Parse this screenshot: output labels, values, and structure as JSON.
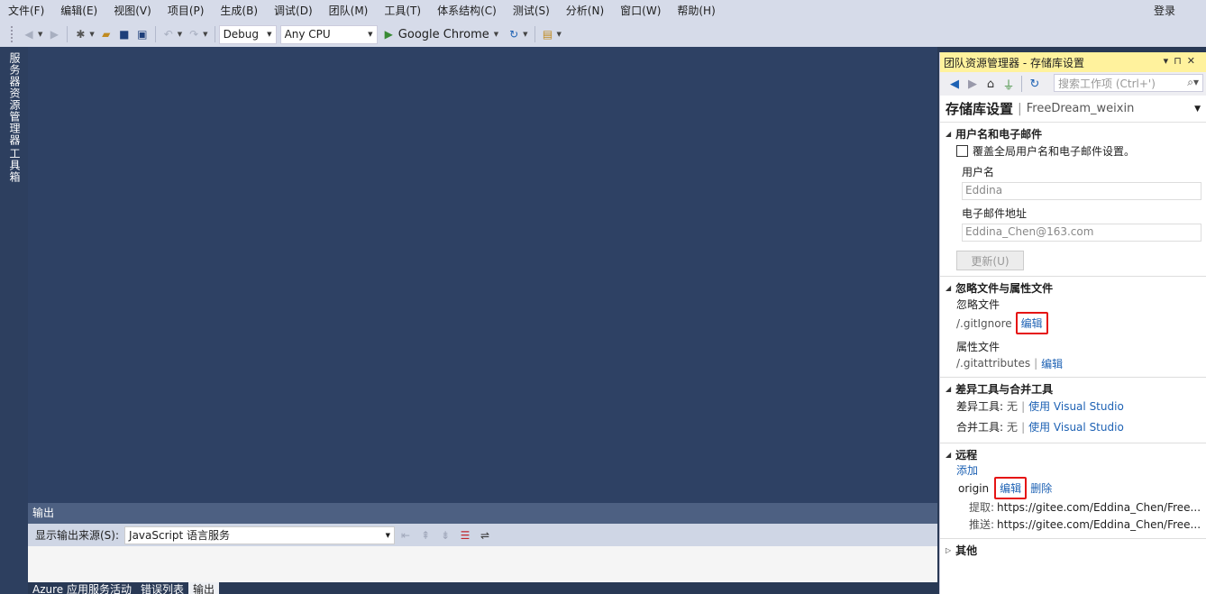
{
  "menu": [
    "文件(F)",
    "编辑(E)",
    "视图(V)",
    "项目(P)",
    "生成(B)",
    "调试(D)",
    "团队(M)",
    "工具(T)",
    "体系结构(C)",
    "测试(S)",
    "分析(N)",
    "窗口(W)",
    "帮助(H)"
  ],
  "login": "登录",
  "toolbar": {
    "config": "Debug",
    "platform": "Any CPU",
    "run_target": "Google Chrome"
  },
  "left_tabs": [
    "服务器资源管理器",
    "工具箱"
  ],
  "output": {
    "title": "输出",
    "source_label": "显示输出来源(S):",
    "source_value": "JavaScript 语言服务"
  },
  "bottom_tabs": [
    "Azure 应用服务活动",
    "错误列表",
    "输出"
  ],
  "panel": {
    "title": "团队资源管理器 - 存储库设置",
    "search_placeholder": "搜索工作项 (Ctrl+')",
    "heading": "存储库设置",
    "repo_name": "FreeDream_weixin",
    "user_section": {
      "title": "用户名和电子邮件",
      "override_label": "覆盖全局用户名和电子邮件设置。",
      "username_label": "用户名",
      "username_value": "Eddina",
      "email_label": "电子邮件地址",
      "email_value": "Eddina_Chen@163.com",
      "update_button": "更新(U)"
    },
    "ignore_section": {
      "title": "忽略文件与属性文件",
      "ignore_label": "忽略文件",
      "ignore_file": "/.gitIgnore",
      "attr_label": "属性文件",
      "attr_file": "/.gitattributes",
      "edit": "编辑"
    },
    "diff_section": {
      "title": "差异工具与合并工具",
      "diff_label": "差异工具:",
      "merge_label": "合并工具:",
      "none": "无",
      "use_vs": "使用 Visual Studio"
    },
    "remote_section": {
      "title": "远程",
      "add": "添加",
      "name": "origin",
      "edit": "编辑",
      "delete": "删除",
      "fetch_label": "提取:",
      "fetch_url": "https://gitee.com/Eddina_Chen/Free...",
      "push_label": "推送:",
      "push_url": "https://gitee.com/Eddina_Chen/Free..."
    },
    "other_section": {
      "title": "其他"
    }
  }
}
